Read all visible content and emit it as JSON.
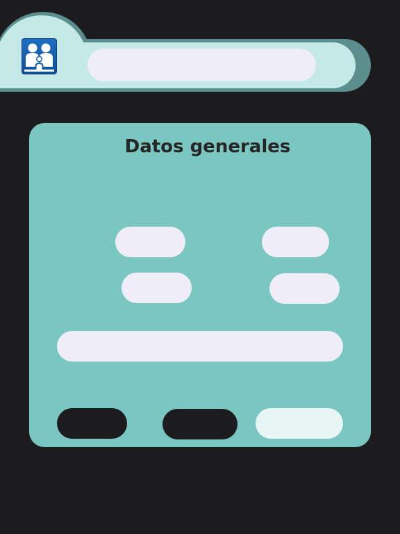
{
  "header": {
    "logo_icon": "family-icon",
    "search": {
      "value": "",
      "placeholder": ""
    }
  },
  "card": {
    "title": "Datos generales",
    "fields": [
      {
        "value": "",
        "placeholder": ""
      },
      {
        "value": "",
        "placeholder": ""
      },
      {
        "value": "",
        "placeholder": ""
      },
      {
        "value": "",
        "placeholder": ""
      },
      {
        "value": "",
        "placeholder": ""
      }
    ],
    "buttons": [
      {
        "label": ""
      },
      {
        "label": ""
      },
      {
        "label": ""
      }
    ]
  },
  "colors": {
    "background": "#1c1c1f",
    "header": "#c5e9e6",
    "header_shadow": "#5a8f8d",
    "card": "#7ac6c1",
    "field": "#eeedf8",
    "button_dark": "#1c1c1f",
    "button_light": "#e7f5f4",
    "logo": "#1462b2"
  }
}
